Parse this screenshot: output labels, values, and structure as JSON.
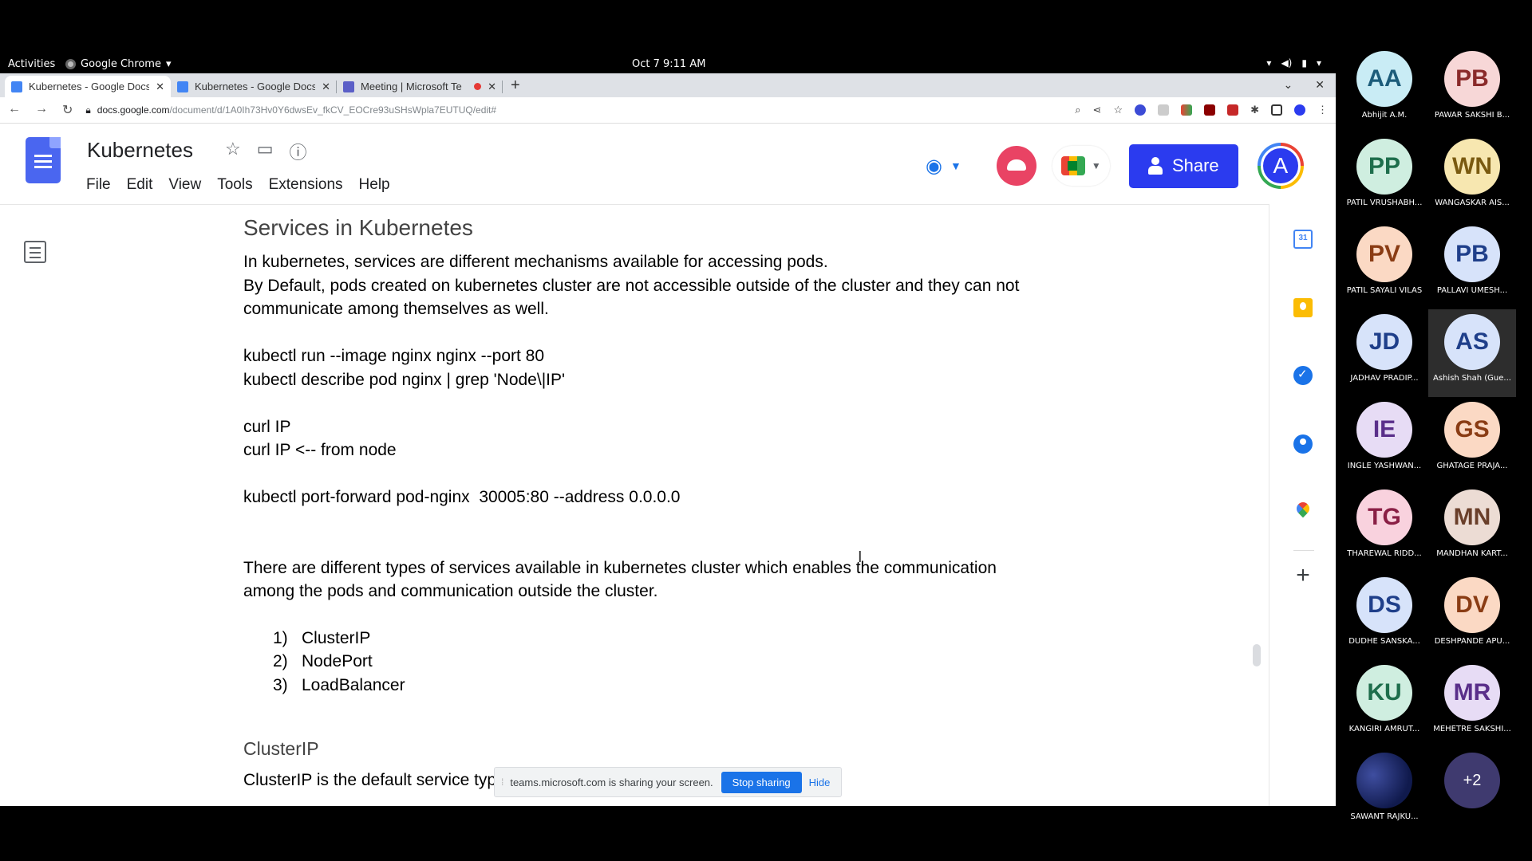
{
  "system": {
    "activities": "Activities",
    "app": "Google Chrome",
    "clock": "Oct 7  9:11 AM"
  },
  "tabs": [
    {
      "title": "Kubernetes - Google Docs",
      "active": true,
      "icon": "docs-icon"
    },
    {
      "title": "Kubernetes - Google Docs",
      "active": false,
      "icon": "docs-icon"
    },
    {
      "title": "Meeting | Microsoft Te",
      "active": false,
      "icon": "teams-icon",
      "recording": true
    }
  ],
  "address": {
    "host": "docs.google.com",
    "path": "/document/d/1A0Ih73Hv0Y6dwsEv_fkCV_EOCre93uSHsWpla7EUTUQ/edit#"
  },
  "docs": {
    "title": "Kubernetes",
    "menu": [
      "File",
      "Edit",
      "View",
      "Tools",
      "Extensions",
      "Help"
    ],
    "share_label": "Share",
    "account_initial": "A"
  },
  "document": {
    "heading1": "Services in Kubernetes",
    "para1": "In kubernetes, services are different mechanisms available for accessing pods.",
    "para2a": "By Default, pods created on kubernetes cluster are not accessible outside of the cluster and they can not",
    "para2b": "communicate among themselves as well.",
    "cmd1": "kubectl run --image nginx nginx --port 80",
    "cmd2": "kubectl describe pod nginx | grep 'Node\\|IP'",
    "cmd3": "curl IP",
    "cmd4": "curl IP <-- from node",
    "cmd5": "kubectl port-forward pod-nginx  30005:80 --address 0.0.0.0",
    "para3a": "There are different types of services available in kubernetes cluster which enables the communication",
    "para3b": "among the pods and communication outside the cluster.",
    "list": [
      {
        "num": "1)",
        "text": "ClusterIP"
      },
      {
        "num": "2)",
        "text": "NodePort"
      },
      {
        "num": "3)",
        "text": "LoadBalancer"
      }
    ],
    "heading2": "ClusterIP",
    "para4": "ClusterIP is the default service type."
  },
  "sidepanel": {
    "calendar_day": "31"
  },
  "sharing": {
    "message": "teams.microsoft.com is sharing your screen.",
    "stop": "Stop sharing",
    "hide": "Hide"
  },
  "participants": [
    {
      "initials": "AA",
      "name": "Abhijit A.M.",
      "bg": "#c9ecf5",
      "fg": "#1c5c7a"
    },
    {
      "initials": "PB",
      "name": "PAWAR SAKSHI B...",
      "bg": "#f7d7d7",
      "fg": "#8a2a2a"
    },
    {
      "initials": "PP",
      "name": "PATIL VRUSHABH...",
      "bg": "#cfeee0",
      "fg": "#1e6e4c"
    },
    {
      "initials": "WN",
      "name": "WANGASKAR AIS...",
      "bg": "#f7e7b0",
      "fg": "#7a5a10"
    },
    {
      "initials": "PV",
      "name": "PATIL SAYALI VILAS",
      "bg": "#fbd9c4",
      "fg": "#8a3c14"
    },
    {
      "initials": "PB",
      "name": "PALLAVI  UMESH...",
      "bg": "#d7e3fa",
      "fg": "#1f3f8a"
    },
    {
      "initials": "JD",
      "name": "JADHAV  PRADIP...",
      "bg": "#d7e3fa",
      "fg": "#1f3f8a"
    },
    {
      "initials": "AS",
      "name": "Ashish Shah (Gue...",
      "bg": "#d7e3fa",
      "fg": "#1f3f8a",
      "selected": true
    },
    {
      "initials": "IE",
      "name": "INGLE YASHWAN...",
      "bg": "#e7dcf5",
      "fg": "#5a2f8a"
    },
    {
      "initials": "GS",
      "name": "GHATAGE PRAJA...",
      "bg": "#fbd9c4",
      "fg": "#8a3c14"
    },
    {
      "initials": "TG",
      "name": "THAREWAL RIDD...",
      "bg": "#f9d2de",
      "fg": "#8a1f45"
    },
    {
      "initials": "MN",
      "name": "MANDHAN KART...",
      "bg": "#ecdcd4",
      "fg": "#6a3f2a"
    },
    {
      "initials": "DS",
      "name": "DUDHE SANSKA...",
      "bg": "#d7e3fa",
      "fg": "#1f3f8a"
    },
    {
      "initials": "DV",
      "name": "DESHPANDE APU...",
      "bg": "#fbd9c4",
      "fg": "#8a3c14"
    },
    {
      "initials": "KU",
      "name": "KANGIRI AMRUT...",
      "bg": "#cfeee0",
      "fg": "#1e6e4c"
    },
    {
      "initials": "MR",
      "name": "MEHETRE SAKSHI...",
      "bg": "#e7dcf5",
      "fg": "#5a2f8a"
    },
    {
      "initials": "",
      "name": "SAWANT RAJKU...",
      "photo": true
    },
    {
      "initials": "+2",
      "name": "",
      "more": true
    }
  ]
}
